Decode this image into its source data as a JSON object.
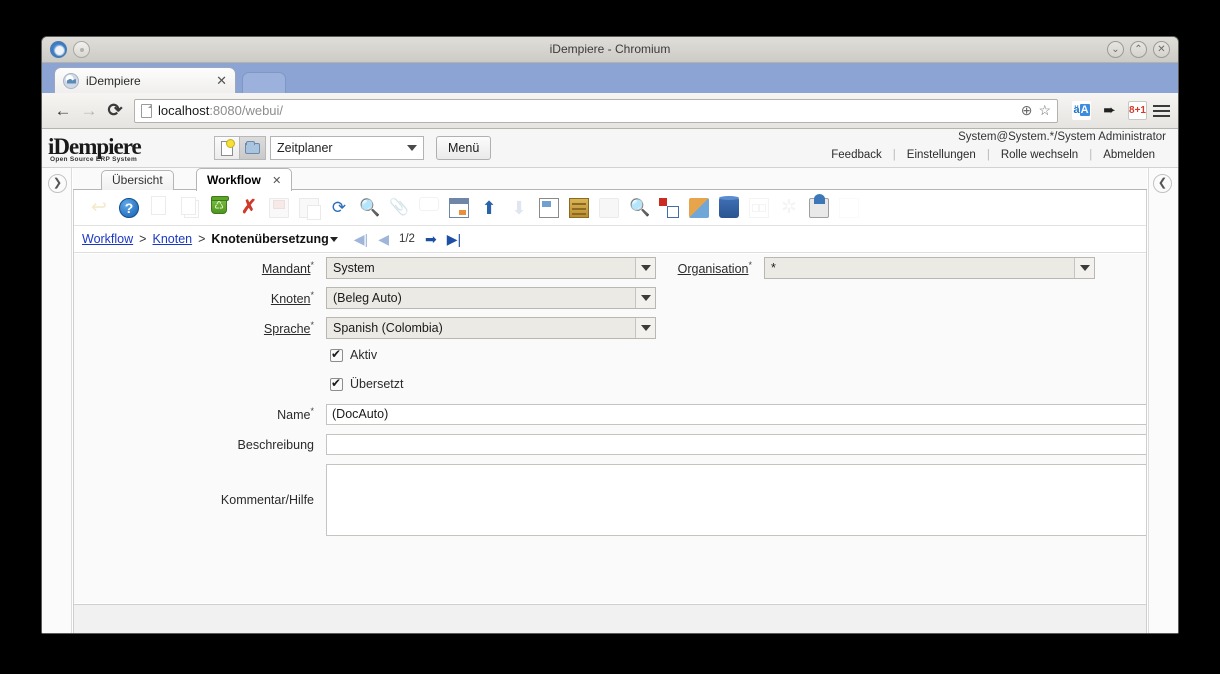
{
  "window": {
    "title": "iDempiere - Chromium",
    "controls": {
      "minimize": "⌄",
      "maximize": "⌃",
      "close": "✕"
    }
  },
  "browser": {
    "tab": {
      "title": "iDempiere",
      "close": "✕"
    },
    "nav": {
      "back": "←",
      "forward": "→",
      "reload": "⟳"
    },
    "omnibox": {
      "url_host": "localhost",
      "url_path": ":8080/webui/",
      "zoom_icon": "⊕",
      "bookmark_icon": "☆"
    },
    "extensions": [
      {
        "name": "translate",
        "label": "A"
      },
      {
        "name": "mobile-view",
        "label": "➨"
      },
      {
        "name": "google-plus",
        "label": "8+1"
      }
    ]
  },
  "appheader": {
    "logo": "iDempiere",
    "logo_sub": "Open Source    ERP System",
    "role_select": "Zeitplaner",
    "menu_button": "Menü",
    "user": "System@System.*/System Administrator",
    "links": [
      "Feedback",
      "Einstellungen",
      "Rolle wechseln",
      "Abmelden"
    ]
  },
  "tabs": [
    {
      "label": "Übersicht",
      "active": false
    },
    {
      "label": "Workflow",
      "active": true,
      "close": "✕"
    }
  ],
  "toolbar": [
    {
      "name": "ignore-icon",
      "glyph": "↩",
      "cls": "g-undo",
      "disabled": true
    },
    {
      "name": "help-icon",
      "glyph": "?",
      "cls": "g-help",
      "disabled": false
    },
    {
      "name": "new-record-icon",
      "glyph": "",
      "cls": "g-doc",
      "disabled": true
    },
    {
      "name": "copy-record-icon",
      "glyph": "",
      "cls": "g-copy",
      "disabled": true
    },
    {
      "name": "delete-record-icon",
      "glyph": "♺",
      "cls": "g-trash",
      "disabled": false
    },
    {
      "name": "delete-selection-icon",
      "glyph": "✗",
      "cls": "g-delx",
      "disabled": false
    },
    {
      "name": "save-record-icon",
      "glyph": "",
      "cls": "g-save",
      "disabled": true
    },
    {
      "name": "save-create-new-icon",
      "glyph": "",
      "cls": "g-savenew",
      "disabled": true
    },
    {
      "name": "refresh-icon",
      "glyph": "⟳",
      "cls": "g-refresh",
      "disabled": false
    },
    {
      "name": "find-icon",
      "glyph": "🔍",
      "cls": "g-find",
      "disabled": false
    },
    {
      "name": "attachment-icon",
      "glyph": "📎",
      "cls": "g-attach",
      "disabled": true
    },
    {
      "name": "chat-icon",
      "glyph": "",
      "cls": "g-chat",
      "disabled": true
    },
    {
      "name": "grid-toggle-icon",
      "glyph": "",
      "cls": "g-grid",
      "disabled": false
    },
    {
      "name": "parent-record-icon",
      "glyph": "⬆",
      "cls": "g-up",
      "disabled": false
    },
    {
      "name": "detail-record-icon",
      "glyph": "⬇",
      "cls": "g-down",
      "disabled": true
    },
    {
      "name": "report-icon",
      "glyph": "",
      "cls": "g-report",
      "disabled": false
    },
    {
      "name": "archive-icon",
      "glyph": "",
      "cls": "g-archive",
      "disabled": false
    },
    {
      "name": "print-icon",
      "glyph": "",
      "cls": "g-print",
      "disabled": true
    },
    {
      "name": "zoom-across-icon",
      "glyph": "🔍",
      "cls": "g-zoomacross",
      "disabled": false
    },
    {
      "name": "active-workflow-icon",
      "glyph": "",
      "cls": "g-activerec",
      "disabled": false
    },
    {
      "name": "requests-icon",
      "glyph": "",
      "cls": "g-request",
      "disabled": false
    },
    {
      "name": "product-info-icon",
      "glyph": "",
      "cls": "g-product",
      "disabled": false
    },
    {
      "name": "export-button-icon",
      "glyph": "",
      "cls": "g-exportbtn",
      "disabled": true
    },
    {
      "name": "preference-gear-icon",
      "glyph": "✲",
      "cls": "g-gear",
      "disabled": true
    },
    {
      "name": "export-data-icon",
      "glyph": "",
      "cls": "g-export",
      "disabled": false
    },
    {
      "name": "email-icon",
      "glyph": "",
      "cls": "g-mail",
      "disabled": true
    }
  ],
  "breadcrumb": {
    "items": [
      {
        "label": "Workflow",
        "link": true
      },
      {
        "label": "Knoten",
        "link": true
      },
      {
        "label": "Knotenübersetzung",
        "link": false
      }
    ],
    "separator": ">",
    "page": "1/2",
    "first": "◀|",
    "prev": "◀",
    "next": "➡",
    "last": "▶|"
  },
  "form": {
    "fields": [
      {
        "name": "mandant",
        "label": "Mandant",
        "required": true,
        "underline": true,
        "type": "select",
        "value": "System"
      },
      {
        "name": "organisation",
        "label": "Organisation",
        "required": true,
        "underline": true,
        "type": "select",
        "value": "*"
      },
      {
        "name": "knoten",
        "label": "Knoten",
        "required": true,
        "underline": true,
        "type": "select",
        "value": "(Beleg Auto)"
      },
      {
        "name": "sprache",
        "label": "Sprache",
        "required": true,
        "underline": true,
        "type": "select",
        "value": "Spanish (Colombia)"
      },
      {
        "name": "aktiv",
        "label": "Aktiv",
        "type": "checkbox",
        "checked": true
      },
      {
        "name": "uebersetzt",
        "label": "Übersetzt",
        "type": "checkbox",
        "checked": true
      },
      {
        "name": "name",
        "label": "Name",
        "required": true,
        "underline": false,
        "type": "text",
        "value": "(DocAuto)"
      },
      {
        "name": "beschreibung",
        "label": "Beschreibung",
        "required": false,
        "underline": false,
        "type": "text",
        "value": ""
      },
      {
        "name": "kommentar-hilfe",
        "label": "Kommentar/Hilfe",
        "required": false,
        "underline": false,
        "type": "textarea",
        "value": ""
      }
    ],
    "required_marker": "*"
  },
  "rails": {
    "left_toggle": "❯",
    "right_toggle": "❮"
  }
}
